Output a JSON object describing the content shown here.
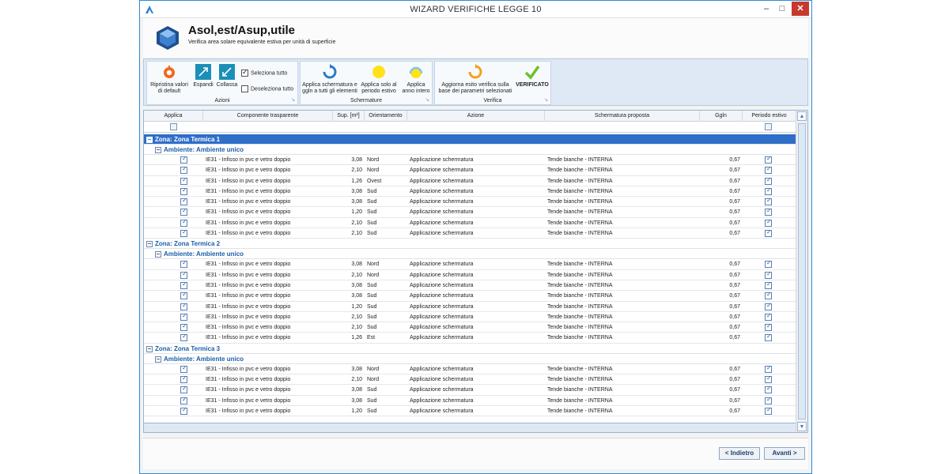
{
  "window": {
    "title": "WIZARD VERIFICHE LEGGE 10",
    "min": "–",
    "max": "□",
    "close": "✕"
  },
  "header": {
    "title": "Asol,est/Asup,utile",
    "subtitle": "Verifica area solare equivalente estiva per unità di superficie"
  },
  "ribbon": {
    "azioni": {
      "label": "Azioni",
      "ripristina": "Ripristina valori di default",
      "espandi": "Espandi",
      "collassa": "Collassa",
      "seleziona": "Seleziona tutto",
      "deseleziona": "Deseleziona tutto"
    },
    "schermature": {
      "label": "Schermature",
      "applica_tutti": "Applica schermatura e ggln a tutti gli elementi",
      "applica_estivo": "Applica solo al periodo estivo",
      "applica_anno": "Applica anno intero"
    },
    "verifica": {
      "label": "Verifica",
      "aggiorna": "Aggiorna esito verifica sulla base dei parametri selezionati",
      "verificato": "VERIFICATO"
    }
  },
  "table": {
    "columns": [
      "Applica",
      "Componente trasparente",
      "Sup. [m²]",
      "Orientamento",
      "Azione",
      "Schermatura proposta",
      "Ggln",
      "Periodo estivo"
    ],
    "zones": [
      {
        "label": "Zona: Zona Termica 1",
        "ambiente": "Ambiente: Ambiente unico",
        "rows": [
          {
            "comp": "IE31 - Infisso in pvc e vetro doppio",
            "sup": "3,08",
            "or": "Nord",
            "az": "Applicazione schermatura",
            "sch": "Tende bianche - INTERNA",
            "ggln": "0,67"
          },
          {
            "comp": "IE31 - Infisso in pvc e vetro doppio",
            "sup": "2,10",
            "or": "Nord",
            "az": "Applicazione schermatura",
            "sch": "Tende bianche - INTERNA",
            "ggln": "0,67"
          },
          {
            "comp": "IE31 - Infisso in pvc e vetro doppio",
            "sup": "1,26",
            "or": "Ovest",
            "az": "Applicazione schermatura",
            "sch": "Tende bianche - INTERNA",
            "ggln": "0,67"
          },
          {
            "comp": "IE31 - Infisso in pvc e vetro doppio",
            "sup": "3,08",
            "or": "Sud",
            "az": "Applicazione schermatura",
            "sch": "Tende bianche - INTERNA",
            "ggln": "0,67"
          },
          {
            "comp": "IE31 - Infisso in pvc e vetro doppio",
            "sup": "3,08",
            "or": "Sud",
            "az": "Applicazione schermatura",
            "sch": "Tende bianche - INTERNA",
            "ggln": "0,67"
          },
          {
            "comp": "IE31 - Infisso in pvc e vetro doppio",
            "sup": "1,20",
            "or": "Sud",
            "az": "Applicazione schermatura",
            "sch": "Tende bianche - INTERNA",
            "ggln": "0,67"
          },
          {
            "comp": "IE31 - Infisso in pvc e vetro doppio",
            "sup": "2,10",
            "or": "Sud",
            "az": "Applicazione schermatura",
            "sch": "Tende bianche - INTERNA",
            "ggln": "0,67"
          },
          {
            "comp": "IE31 - Infisso in pvc e vetro doppio",
            "sup": "2,10",
            "or": "Sud",
            "az": "Applicazione schermatura",
            "sch": "Tende bianche - INTERNA",
            "ggln": "0,67"
          }
        ]
      },
      {
        "label": "Zona: Zona Termica 2",
        "ambiente": "Ambiente: Ambiente unico",
        "rows": [
          {
            "comp": "IE31 - Infisso in pvc e vetro doppio",
            "sup": "3,08",
            "or": "Nord",
            "az": "Applicazione schermatura",
            "sch": "Tende bianche - INTERNA",
            "ggln": "0,67"
          },
          {
            "comp": "IE31 - Infisso in pvc e vetro doppio",
            "sup": "2,10",
            "or": "Nord",
            "az": "Applicazione schermatura",
            "sch": "Tende bianche - INTERNA",
            "ggln": "0,67"
          },
          {
            "comp": "IE31 - Infisso in pvc e vetro doppio",
            "sup": "3,08",
            "or": "Sud",
            "az": "Applicazione schermatura",
            "sch": "Tende bianche - INTERNA",
            "ggln": "0,67"
          },
          {
            "comp": "IE31 - Infisso in pvc e vetro doppio",
            "sup": "3,08",
            "or": "Sud",
            "az": "Applicazione schermatura",
            "sch": "Tende bianche - INTERNA",
            "ggln": "0,67"
          },
          {
            "comp": "IE31 - Infisso in pvc e vetro doppio",
            "sup": "1,20",
            "or": "Sud",
            "az": "Applicazione schermatura",
            "sch": "Tende bianche - INTERNA",
            "ggln": "0,67"
          },
          {
            "comp": "IE31 - Infisso in pvc e vetro doppio",
            "sup": "2,10",
            "or": "Sud",
            "az": "Applicazione schermatura",
            "sch": "Tende bianche - INTERNA",
            "ggln": "0,67"
          },
          {
            "comp": "IE31 - Infisso in pvc e vetro doppio",
            "sup": "2,10",
            "or": "Sud",
            "az": "Applicazione schermatura",
            "sch": "Tende bianche - INTERNA",
            "ggln": "0,67"
          },
          {
            "comp": "IE31 - Infisso in pvc e vetro doppio",
            "sup": "1,26",
            "or": "Est",
            "az": "Applicazione schermatura",
            "sch": "Tende bianche - INTERNA",
            "ggln": "0,67"
          }
        ]
      },
      {
        "label": "Zona: Zona Termica 3",
        "ambiente": "Ambiente: Ambiente unico",
        "rows": [
          {
            "comp": "IE31 - Infisso in pvc e vetro doppio",
            "sup": "3,08",
            "or": "Nord",
            "az": "Applicazione schermatura",
            "sch": "Tende bianche - INTERNA",
            "ggln": "0,67"
          },
          {
            "comp": "IE31 - Infisso in pvc e vetro doppio",
            "sup": "2,10",
            "or": "Nord",
            "az": "Applicazione schermatura",
            "sch": "Tende bianche - INTERNA",
            "ggln": "0,67"
          },
          {
            "comp": "IE31 - Infisso in pvc e vetro doppio",
            "sup": "3,08",
            "or": "Sud",
            "az": "Applicazione schermatura",
            "sch": "Tende bianche - INTERNA",
            "ggln": "0,67"
          },
          {
            "comp": "IE31 - Infisso in pvc e vetro doppio",
            "sup": "3,08",
            "or": "Sud",
            "az": "Applicazione schermatura",
            "sch": "Tende bianche - INTERNA",
            "ggln": "0,67"
          },
          {
            "comp": "IE31 - Infisso in pvc e vetro doppio",
            "sup": "1,20",
            "or": "Sud",
            "az": "Applicazione schermatura",
            "sch": "Tende bianche - INTERNA",
            "ggln": "0,67"
          }
        ]
      }
    ]
  },
  "footer": {
    "back": "< Indietro",
    "next": "Avanti >"
  },
  "colors": {
    "accent": "#2f6ec8",
    "group_text": "#1a5fa8",
    "close": "#c7392c"
  }
}
